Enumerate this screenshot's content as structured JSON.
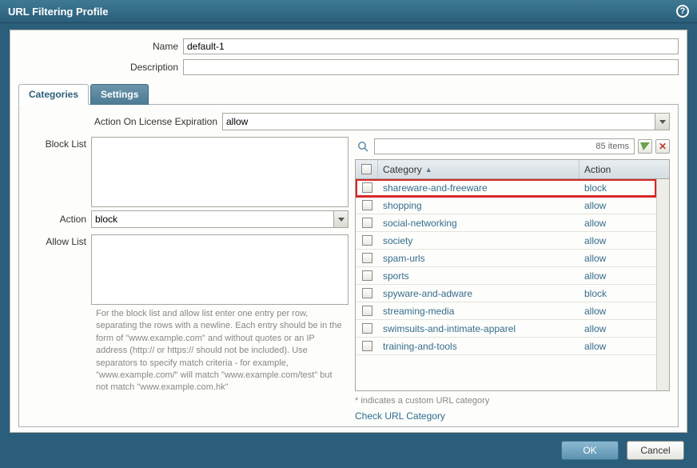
{
  "header": {
    "title": "URL Filtering Profile"
  },
  "form": {
    "name_label": "Name",
    "name_value": "default-1",
    "desc_label": "Description",
    "desc_value": ""
  },
  "tabs": {
    "categories": "Categories",
    "settings": "Settings",
    "active": "categories"
  },
  "license": {
    "label": "Action On License Expiration",
    "value": "allow"
  },
  "left": {
    "block_label": "Block List",
    "block_value": "",
    "action_label": "Action",
    "action_value": "block",
    "allow_label": "Allow List",
    "allow_value": "",
    "help_text": "For the block list and allow list enter one entry per row, separating the rows with a newline. Each entry should be in the form of \"www.example.com\" and without quotes or an IP address (http:// or https:// should not be included). Use separators to specify match criteria - for example, \"www.example.com/\" will match \"www.example.com/test\" but not match \"www.example.com.hk\""
  },
  "grid": {
    "search_count": "85 items",
    "col_category": "Category",
    "col_action": "Action",
    "footer_note": "* indicates a custom URL category",
    "check_link": "Check URL Category",
    "rows": [
      {
        "cat": "shareware-and-freeware",
        "act": "block",
        "highlight": true
      },
      {
        "cat": "shopping",
        "act": "allow"
      },
      {
        "cat": "social-networking",
        "act": "allow"
      },
      {
        "cat": "society",
        "act": "allow"
      },
      {
        "cat": "spam-urls",
        "act": "allow"
      },
      {
        "cat": "sports",
        "act": "allow"
      },
      {
        "cat": "spyware-and-adware",
        "act": "block"
      },
      {
        "cat": "streaming-media",
        "act": "allow"
      },
      {
        "cat": "swimsuits-and-intimate-apparel",
        "act": "allow"
      },
      {
        "cat": "training-and-tools",
        "act": "allow"
      }
    ]
  },
  "footer": {
    "ok": "OK",
    "cancel": "Cancel"
  }
}
